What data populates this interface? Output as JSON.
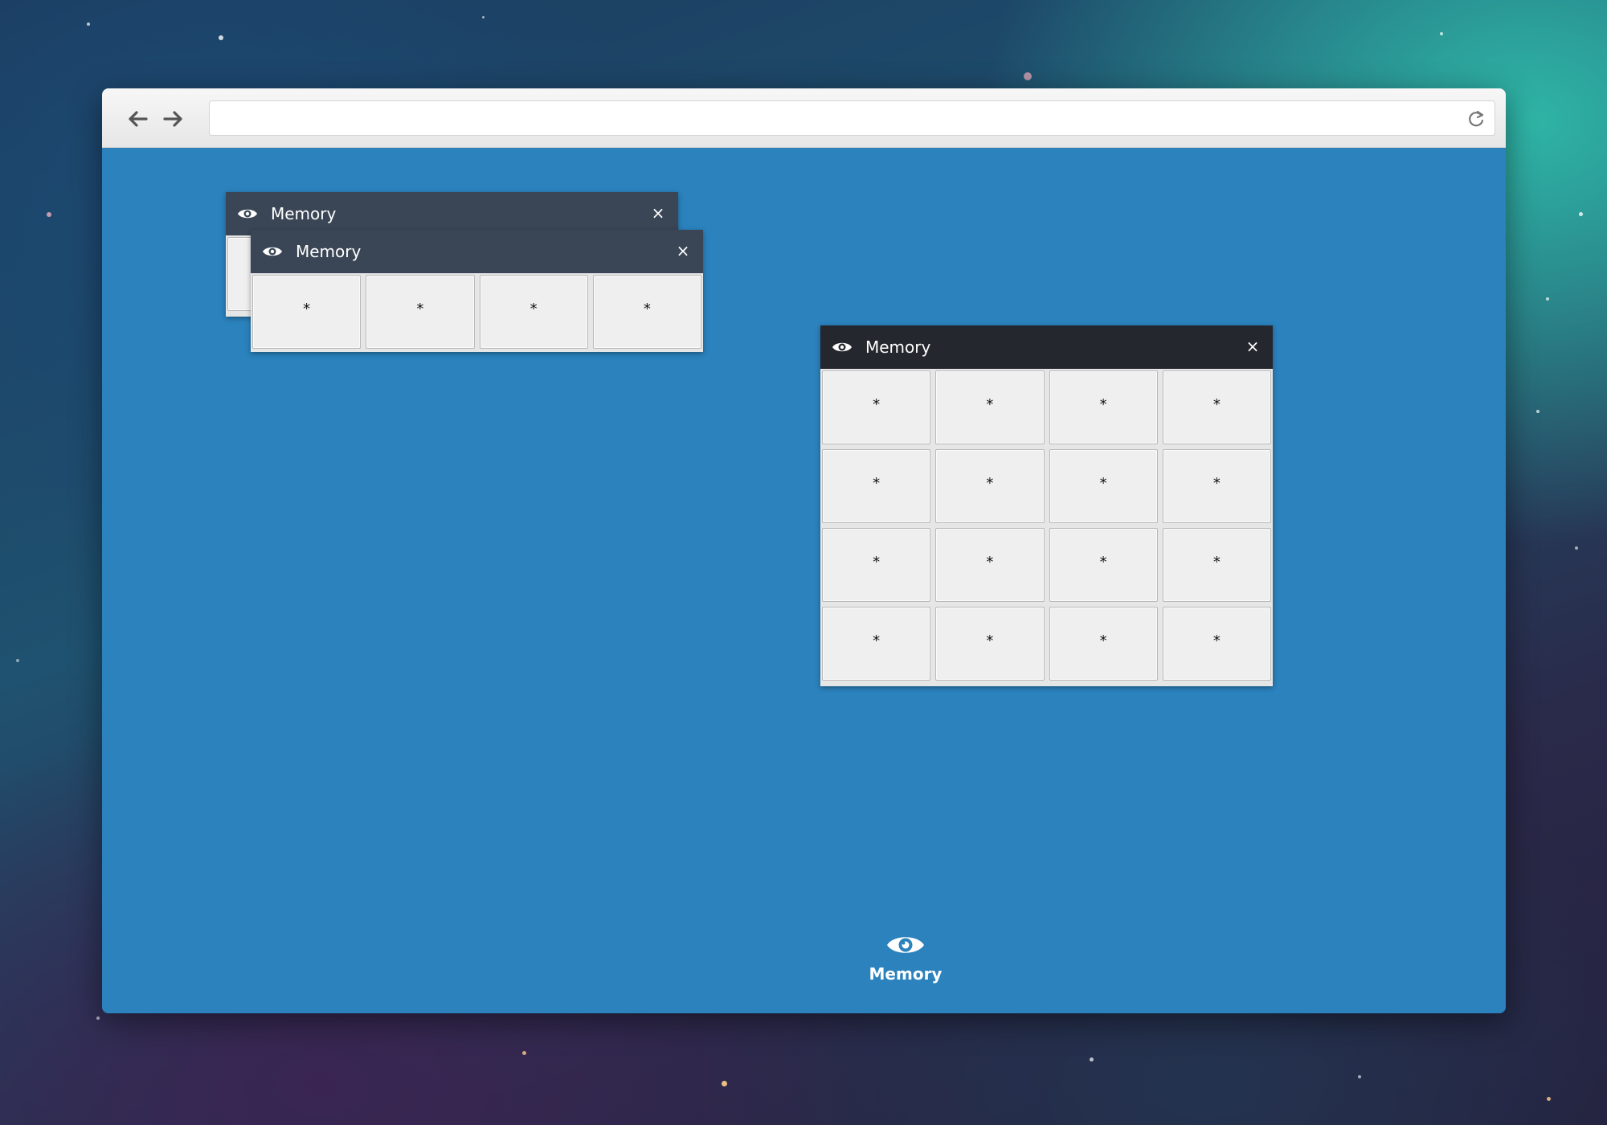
{
  "desktop": {
    "dock": {
      "label": "Memory",
      "icon": "eye-icon"
    }
  },
  "browser": {
    "url": "",
    "back_icon": "arrow-left-icon",
    "forward_icon": "arrow-right-icon",
    "reload_icon": "reload-icon"
  },
  "windows": [
    {
      "title": "Memory",
      "close_label": "×",
      "state": "behind",
      "cells": [
        "*",
        "*",
        "*",
        "*"
      ]
    },
    {
      "title": "Memory",
      "close_label": "×",
      "state": "inactive",
      "cells": [
        "*",
        "*",
        "*",
        "*"
      ]
    },
    {
      "title": "Memory",
      "close_label": "×",
      "state": "active",
      "cells": [
        "*",
        "*",
        "*",
        "*",
        "*",
        "*",
        "*",
        "*",
        "*",
        "*",
        "*",
        "*",
        "*",
        "*",
        "*",
        "*"
      ]
    }
  ],
  "colors": {
    "content_bg": "#2b82bd",
    "titlebar_inactive": "#3a4655",
    "titlebar_active": "#24272d",
    "cell_bg": "#efefef"
  }
}
